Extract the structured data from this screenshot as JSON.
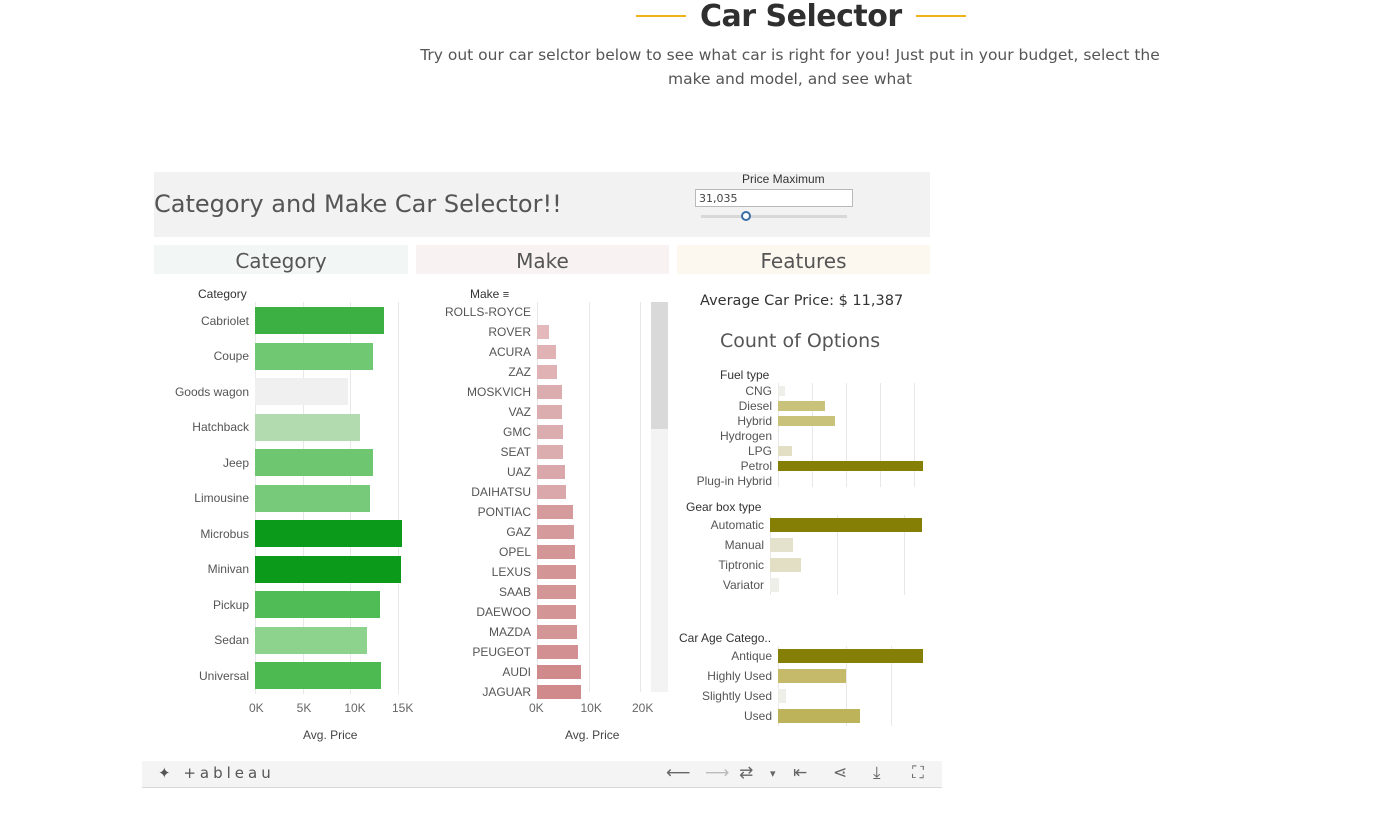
{
  "page": {
    "title": "Car Selector",
    "subtitle": "Try out our car selctor below to see what car is right for you! Just put in your budget, select the make and model, and see what"
  },
  "dashboard": {
    "title": "Category and Make Car Selector!!",
    "price_max": {
      "label": "Price Maximum",
      "value": "31,035"
    },
    "sections": {
      "category": "Category",
      "make": "Make",
      "features": "Features"
    }
  },
  "category_chart": {
    "field_label": "Category",
    "axis_title": "Avg. Price",
    "ticks": [
      "0K",
      "5K",
      "10K",
      "15K"
    ],
    "rows": [
      {
        "label": "Cabriolet",
        "value": 13500,
        "color": "#3cb043"
      },
      {
        "label": "Coupe",
        "value": 12400,
        "color": "#70c873"
      },
      {
        "label": "Goods wagon",
        "value": 9800,
        "color": "#f0f0f0"
      },
      {
        "label": "Hatchback",
        "value": 11000,
        "color": "#b2dcb0"
      },
      {
        "label": "Jeep",
        "value": 12400,
        "color": "#6ec671"
      },
      {
        "label": "Limousine",
        "value": 12100,
        "color": "#78ca7b"
      },
      {
        "label": "Microbus",
        "value": 15400,
        "color": "#0b9a1a"
      },
      {
        "label": "Minivan",
        "value": 15300,
        "color": "#0b9a1a"
      },
      {
        "label": "Pickup",
        "value": 13100,
        "color": "#50bc55"
      },
      {
        "label": "Sedan",
        "value": 11700,
        "color": "#8dd38d"
      },
      {
        "label": "Universal",
        "value": 13200,
        "color": "#4cba51"
      }
    ]
  },
  "make_chart": {
    "field_label": "Make",
    "axis_title": "Avg. Price",
    "ticks": [
      "0K",
      "10K",
      "20K"
    ],
    "rows": [
      {
        "label": "ROLLS-ROYCE",
        "value": 0,
        "color": "#e4b9bb"
      },
      {
        "label": "ROVER",
        "value": 2400,
        "color": "#e4b9bb"
      },
      {
        "label": "ACURA",
        "value": 3700,
        "color": "#e0b2b4"
      },
      {
        "label": "ZAZ",
        "value": 3900,
        "color": "#e0b2b4"
      },
      {
        "label": "MOSKVICH",
        "value": 4800,
        "color": "#dcadaf"
      },
      {
        "label": "VAZ",
        "value": 4900,
        "color": "#dcadaf"
      },
      {
        "label": "GMC",
        "value": 5100,
        "color": "#dcadaf"
      },
      {
        "label": "SEAT",
        "value": 5100,
        "color": "#dcadaf"
      },
      {
        "label": "UAZ",
        "value": 5500,
        "color": "#daa8aa"
      },
      {
        "label": "DAIHATSU",
        "value": 5700,
        "color": "#daa8aa"
      },
      {
        "label": "PONTIAC",
        "value": 7000,
        "color": "#d49a9c"
      },
      {
        "label": "GAZ",
        "value": 7200,
        "color": "#d49a9c"
      },
      {
        "label": "OPEL",
        "value": 7400,
        "color": "#d49597"
      },
      {
        "label": "LEXUS",
        "value": 7500,
        "color": "#d49597"
      },
      {
        "label": "SAAB",
        "value": 7500,
        "color": "#d49597"
      },
      {
        "label": "DAEWOO",
        "value": 7500,
        "color": "#d49597"
      },
      {
        "label": "MAZDA",
        "value": 7700,
        "color": "#d49597"
      },
      {
        "label": "PEUGEOT",
        "value": 8000,
        "color": "#d29092"
      },
      {
        "label": "AUDI",
        "value": 8500,
        "color": "#d08a8c"
      },
      {
        "label": "JAGUAR",
        "value": 8500,
        "color": "#d08a8c"
      }
    ]
  },
  "features": {
    "avg_price_label": "Average Car Price: $ 11,387",
    "count_title": "Count of Options",
    "fuel": {
      "field_label": "Fuel type",
      "rows": [
        {
          "label": "CNG",
          "value": 7,
          "color": "#efefea"
        },
        {
          "label": "Diesel",
          "value": 47,
          "color": "#c9c27a"
        },
        {
          "label": "Hybrid",
          "value": 57,
          "color": "#c9c27a"
        },
        {
          "label": "Hydrogen",
          "value": 0,
          "color": "#efefea"
        },
        {
          "label": "LPG",
          "value": 14,
          "color": "#e2dfc4"
        },
        {
          "label": "Petrol",
          "value": 145,
          "color": "#867f05"
        },
        {
          "label": "Plug-in Hybrid",
          "value": 0,
          "color": "#efefea"
        }
      ]
    },
    "gearbox": {
      "field_label": "Gear box type",
      "rows": [
        {
          "label": "Automatic",
          "value": 152,
          "color": "#867f05"
        },
        {
          "label": "Manual",
          "value": 23,
          "color": "#e4e1cc"
        },
        {
          "label": "Tiptronic",
          "value": 31,
          "color": "#e2dfc4"
        },
        {
          "label": "Variator",
          "value": 9,
          "color": "#efefea"
        }
      ]
    },
    "age": {
      "field_label": "Car Age Catego..",
      "rows": [
        {
          "label": "Antique",
          "value": 145,
          "color": "#867f05"
        },
        {
          "label": "Highly Used",
          "value": 68,
          "color": "#c4ba6a"
        },
        {
          "label": "Slightly Used",
          "value": 8,
          "color": "#efefea"
        },
        {
          "label": "Used",
          "value": 82,
          "color": "#bdb35b"
        }
      ]
    }
  },
  "toolbar": {
    "logo": "+ableau",
    "undo": "⟵",
    "redo": "⟶",
    "revert": "⇄",
    "dropdown": "▾",
    "reset": "⇤",
    "share": "⋖",
    "download": "⤓",
    "fullscreen": "⛶"
  }
}
